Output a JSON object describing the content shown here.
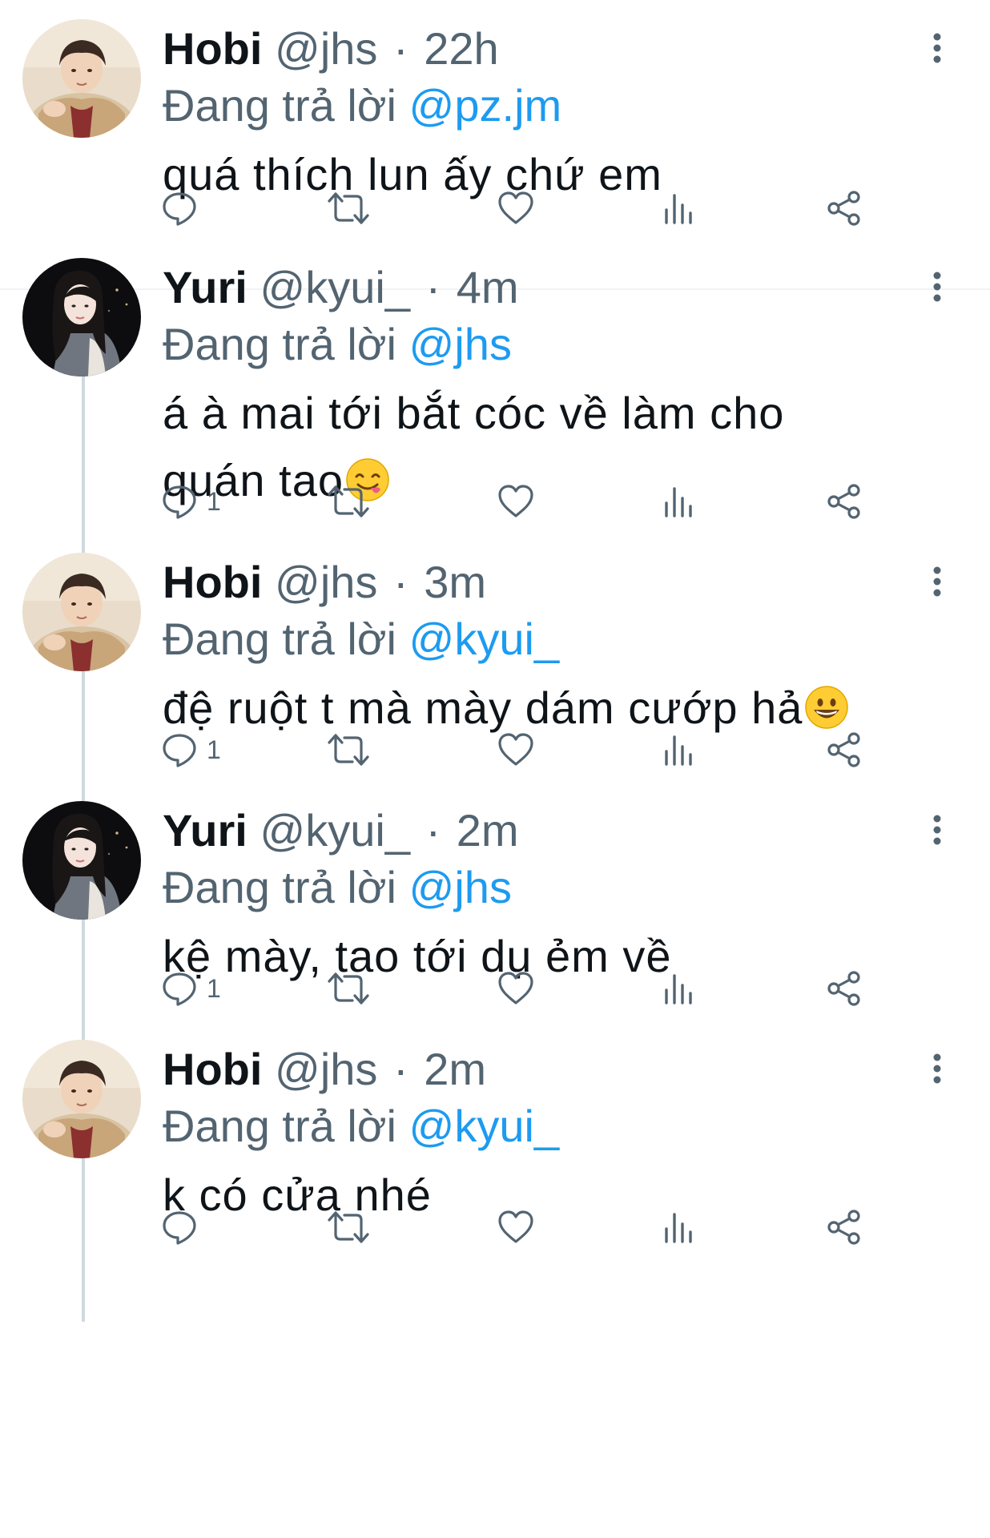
{
  "thread": {
    "tweets": [
      {
        "name": "Hobi",
        "handle": "@jhs",
        "separator": "·",
        "time": "22h",
        "reply_prefix": "Đang trả lời",
        "reply_to": "@pz.jm",
        "text": "quá thích lun ấy chứ em",
        "emoji": "",
        "reply_count": "",
        "avatar": "hobi-avatar"
      },
      {
        "name": "Yuri",
        "handle": "@kyui_",
        "separator": "·",
        "time": "4m",
        "reply_prefix": "Đang trả lời",
        "reply_to": "@jhs",
        "text": "á à mai tới bắt cóc về làm cho quán tao",
        "emoji": "face-savoring-food-emoji",
        "reply_count": "1",
        "avatar": "yuri-avatar"
      },
      {
        "name": "Hobi",
        "handle": "@jhs",
        "separator": "·",
        "time": "3m",
        "reply_prefix": "Đang trả lời",
        "reply_to": "@kyui_",
        "text": "đệ ruột t mà mày dám cướp hả",
        "emoji": "grinning-face-emoji",
        "reply_count": "1",
        "avatar": "hobi-avatar"
      },
      {
        "name": "Yuri",
        "handle": "@kyui_",
        "separator": "·",
        "time": "2m",
        "reply_prefix": "Đang trả lời",
        "reply_to": "@jhs",
        "text": "kệ mày, tao tới dụ ẻm về",
        "emoji": "",
        "reply_count": "1",
        "avatar": "yuri-avatar"
      },
      {
        "name": "Hobi",
        "handle": "@jhs",
        "separator": "·",
        "time": "2m",
        "reply_prefix": "Đang trả lời",
        "reply_to": "@kyui_",
        "text": "k có cửa nhé",
        "emoji": "",
        "reply_count": "",
        "avatar": "hobi-avatar"
      }
    ],
    "action_icons": [
      "reply-icon",
      "retweet-icon",
      "like-icon",
      "analytics-icon",
      "share-icon"
    ],
    "colors": {
      "text": "#0f1419",
      "secondary": "#536471",
      "mention": "#1d9bf0",
      "thread_line": "#cfd9de",
      "divider": "#eff3f4"
    }
  }
}
